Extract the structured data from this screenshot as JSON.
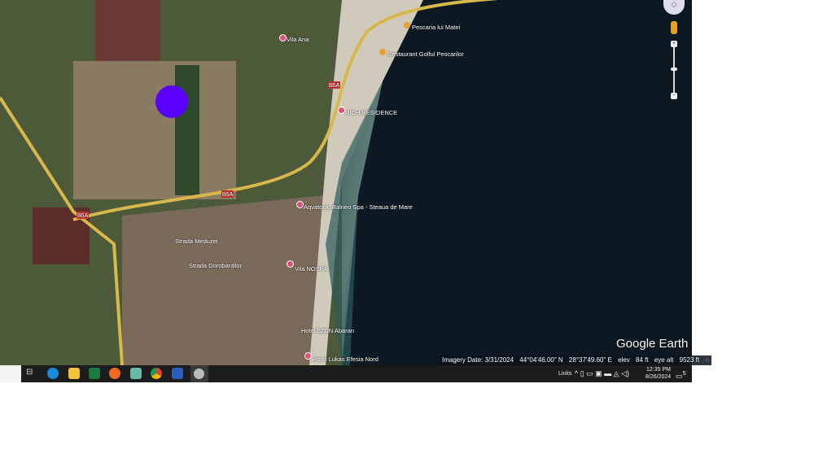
{
  "map": {
    "labels": [
      "Pescaria lui Matei",
      "Restaurant Golful Pescarilor",
      "Vila Ana",
      "RICH RESIDENCE",
      "Aqvatonic Balneo Spa - Steaua de Mare",
      "Strada Meduzei",
      "Strada Dorobanților",
      "Vila NOSPA",
      "Hotel 5ZDN Abaran",
      "Hotel Lukas Efesia Nord"
    ],
    "road_labels": [
      "86A",
      "86A",
      "86A"
    ],
    "highlight_color": "#5a00ff"
  },
  "status": {
    "imagery_date": "Imagery Date: 3/31/2024",
    "lat": "44°04'46.00\" N",
    "lon": "28°37'49.60\" E",
    "elev_label": "elev",
    "elev": "84 ft",
    "eye_label": "eye alt",
    "eye_alt": "9523 ft"
  },
  "logo": "Google Earth",
  "controls": {
    "zoom_in": "+",
    "zoom_out": "−"
  },
  "taskbar": {
    "apps": [
      "task-view",
      "edge",
      "file-explorer",
      "excel",
      "firefox",
      "app",
      "chrome",
      "word",
      "google-earth"
    ],
    "links": "Links",
    "time": "12:35 PM",
    "date": "8/26/2024",
    "notifications": "5"
  }
}
